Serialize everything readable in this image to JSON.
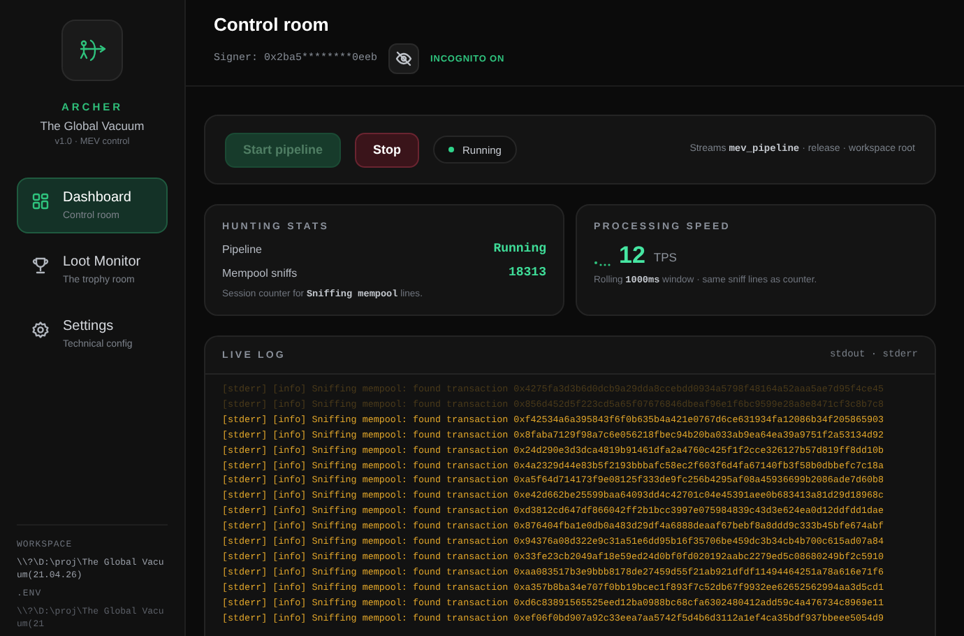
{
  "sidebar": {
    "brand": "ARCHER",
    "title": "The Global Vacuum",
    "version": "v1.0 · MEV control",
    "items": [
      {
        "kind": "dashboard",
        "label": "Dashboard",
        "sub": "Control room",
        "selected": true
      },
      {
        "kind": "trophy",
        "label": "Loot Monitor",
        "sub": "The trophy room",
        "selected": false
      },
      {
        "kind": "settings",
        "label": "Settings",
        "sub": "Technical config",
        "selected": false
      }
    ],
    "footer": {
      "heading": "WORKSPACE",
      "path": "\\\\?\\D:\\proj\\The Global Vacuum(21.04.26)",
      "env_heading": ".ENV",
      "env_path": "\\\\?\\D:\\proj\\The Global Vacuum(21"
    }
  },
  "header": {
    "title": "Control room",
    "signer": "Signer: 0x2ba5********0eeb",
    "incognito": true,
    "incognito_label": "INCOGNITO ON"
  },
  "controls": {
    "start": {
      "label": "Start pipeline",
      "disabled": true
    },
    "stop": {
      "label": "Stop",
      "disabled": false
    },
    "status": {
      "label": "Running",
      "running": true
    },
    "note": "Streams **mev_pipeline** · release · workspace root"
  },
  "hunting_stats": {
    "title": "HUNTING STATS",
    "rows": [
      {
        "label": "Pipeline",
        "value": "Running"
      },
      {
        "label": "Mempool sniffs",
        "value": "18313"
      }
    ],
    "note": "Session counter for **Sniffing mempool** lines."
  },
  "processing_speed": {
    "title": "PROCESSING SPEED",
    "value": "12",
    "unit": "TPS",
    "note": "Rolling **1000ms** window · same sniff lines as counter."
  },
  "live_log": {
    "title": "LIVE LOG",
    "streams": "stdout · stderr",
    "lines": [
      {
        "text": "[stderr] [info] Sniffing mempool: found transaction 0x4275fa3d3b6d0dcb9a29dda8ccebdd0934a5798f48164a52aaa5ae7d95f4ce45",
        "dimmed": true
      },
      {
        "text": "[stderr] [info] Sniffing mempool: found transaction 0x856d452d5f223cd5a65f07676846dbeaf96e1f6bc9599e28a8e8471cf3c8b7c8",
        "dimmed": true
      },
      {
        "text": "[stderr] [info] Sniffing mempool: found transaction 0xf42534a6a395843f6f0b635b4a421e0767d6ce631934fa12086b34f205865903",
        "dimmed": false
      },
      {
        "text": "[stderr] [info] Sniffing mempool: found transaction 0x8faba7129f98a7c6e056218fbec94b20ba033ab9ea64ea39a9751f2a53134d92",
        "dimmed": false
      },
      {
        "text": "[stderr] [info] Sniffing mempool: found transaction 0x24d290e3d3dca4819b91461dfa2a4760c425f1f2cce326127b57d819ff8dd10b",
        "dimmed": false
      },
      {
        "text": "[stderr] [info] Sniffing mempool: found transaction 0x4a2329d44e83b5f2193bbbafc58ec2f603f6d4fa67140fb3f58b0dbbefc7c18a",
        "dimmed": false
      },
      {
        "text": "[stderr] [info] Sniffing mempool: found transaction 0xa5f64d714173f9e08125f333de9fc256b4295af08a45936699b2086ade7d60b8",
        "dimmed": false
      },
      {
        "text": "[stderr] [info] Sniffing mempool: found transaction 0xe42d662be25599baa64093dd4c42701c04e45391aee0b683413a81d29d18968c",
        "dimmed": false
      },
      {
        "text": "[stderr] [info] Sniffing mempool: found transaction 0xd3812cd647df866042ff2b1bcc3997e075984839c43d3e624ea0d12ddfdd1dae",
        "dimmed": false
      },
      {
        "text": "[stderr] [info] Sniffing mempool: found transaction 0x876404fba1e0db0a483d29df4a6888deaaf67bebf8a8ddd9c333b45bfe674abf",
        "dimmed": false
      },
      {
        "text": "[stderr] [info] Sniffing mempool: found transaction 0x94376a08d322e9c31a51e6dd95b16f35706be459dc3b34cb4b700c615ad07a84",
        "dimmed": false
      },
      {
        "text": "[stderr] [info] Sniffing mempool: found transaction 0x33fe23cb2049af18e59ed24d0bf0fd020192aabc2279ed5c08680249bf2c5910",
        "dimmed": false
      },
      {
        "text": "[stderr] [info] Sniffing mempool: found transaction 0xaa083517b3e9bbb8178de27459d55f21ab921dfdf11494464251a78a616e71f6",
        "dimmed": false
      },
      {
        "text": "[stderr] [info] Sniffing mempool: found transaction 0xa357b8ba34e707f0bb19bcec1f893f7c52db67f9932ee62652562994aa3d5cd1",
        "dimmed": false
      },
      {
        "text": "[stderr] [info] Sniffing mempool: found transaction 0xd6c83891565525eed12ba0988bc68cfa6302480412add59c4a476734c8969e11",
        "dimmed": false
      },
      {
        "text": "[stderr] [info] Sniffing mempool: found transaction 0xef06f0bd907a92c33eea7aa5742f5d4b6d3112a1ef4ca35bdf937bbeee5054d9",
        "dimmed": false
      }
    ]
  }
}
